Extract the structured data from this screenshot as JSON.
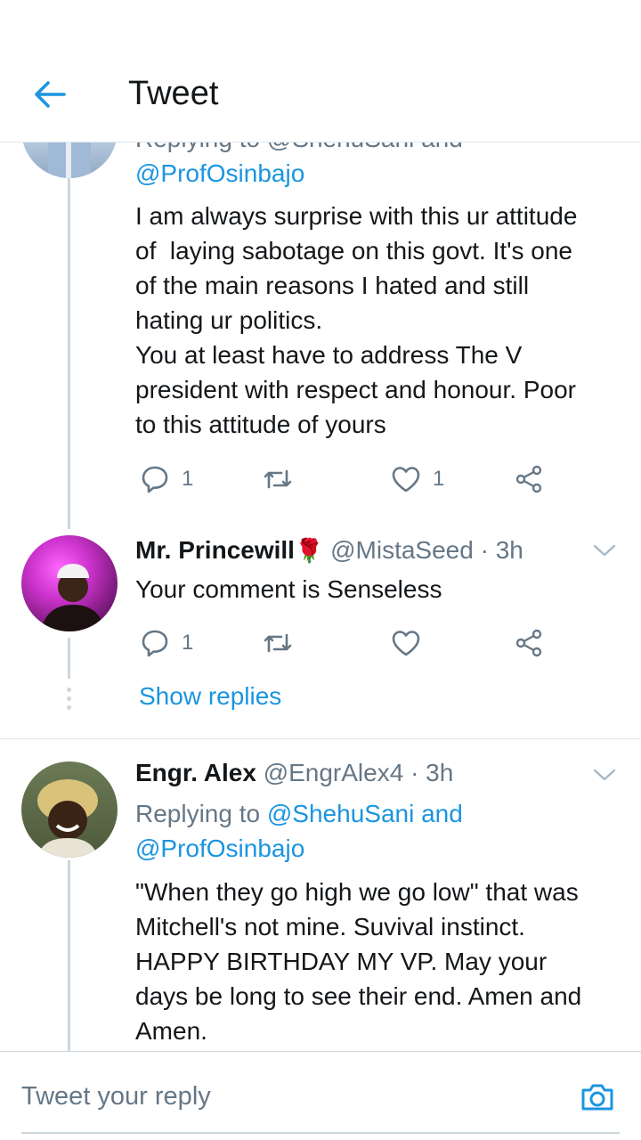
{
  "header": {
    "title": "Tweet"
  },
  "tweets": [
    {
      "replying_cut": "Replying to @ShehuSani and",
      "replying_handle2": "@ProfOsinbajo",
      "lines": [
        "I am always surprise with this ur attitude",
        "of  laying sabotage on this govt. It's one",
        "of the main reasons I hated and still",
        "hating ur politics.",
        "You at least have to address The V",
        "president with respect and honour. Poor",
        "to this attitude of yours"
      ],
      "reply_count": "1",
      "like_count": "1"
    },
    {
      "name": "Mr. Princewill",
      "emoji": "🌹",
      "handle": "@MistaSeed",
      "time": "· 3h",
      "text": "Your comment is Senseless",
      "reply_count": "1",
      "show_replies": "Show replies"
    },
    {
      "name": "Engr. Alex",
      "handle": "@EngrAlex4",
      "time": "· 3h",
      "replying_prefix": "Replying to",
      "replying_handle1": "@ShehuSani",
      "replying_and": "and",
      "replying_handle2": "@ProfOsinbajo",
      "lines": [
        "\"When they go high we go low\" that was",
        "Mitchell's not mine. Suvival instinct.",
        "HAPPY BIRTHDAY MY VP. May your",
        "days be long to see their end. Amen and",
        "Amen."
      ]
    }
  ],
  "composer": {
    "placeholder": "Tweet your reply"
  },
  "colors": {
    "accent": "#1b95e0",
    "muted": "#657786",
    "line": "#ccd6dd"
  },
  "icons": [
    "back-arrow-icon",
    "reply-icon",
    "retweet-icon",
    "like-icon",
    "share-icon",
    "chevron-down-icon",
    "camera-icon"
  ]
}
